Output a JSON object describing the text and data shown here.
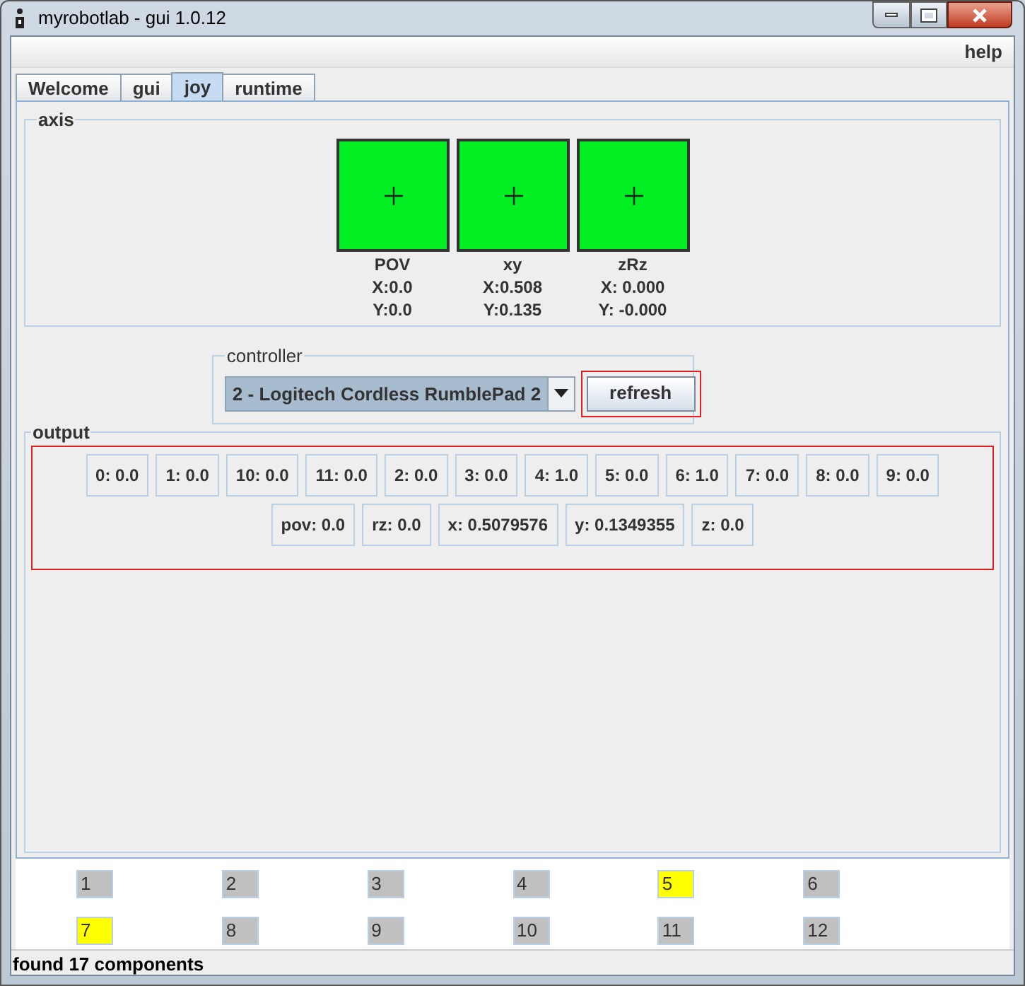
{
  "window": {
    "title": "myrobotlab - gui 1.0.12"
  },
  "menu": [
    "help"
  ],
  "tabs": [
    {
      "label": "Welcome",
      "selected": false
    },
    {
      "label": "gui",
      "selected": false
    },
    {
      "label": "joy",
      "selected": true
    },
    {
      "label": "runtime",
      "selected": false
    }
  ],
  "axis": {
    "title": "axis",
    "pads": [
      {
        "name": "POV",
        "x": "X:0.0",
        "y": "Y:0.0"
      },
      {
        "name": "xy",
        "x": "X:0.508",
        "y": "Y:0.135"
      },
      {
        "name": "zRz",
        "x": "X: 0.000",
        "y": "Y: -0.000"
      }
    ]
  },
  "controller": {
    "title": "controller",
    "selected": "2 - Logitech Cordless RumblePad 2",
    "button": "refresh"
  },
  "output": {
    "title": "output",
    "values": [
      {
        "label": "0:",
        "value": "0.0"
      },
      {
        "label": "1:",
        "value": "0.0"
      },
      {
        "label": "10:",
        "value": "0.0"
      },
      {
        "label": "11:",
        "value": "0.0"
      },
      {
        "label": "2:",
        "value": "0.0"
      },
      {
        "label": "3:",
        "value": "0.0"
      },
      {
        "label": "4:",
        "value": "1.0"
      },
      {
        "label": "5:",
        "value": "0.0"
      },
      {
        "label": "6:",
        "value": "1.0"
      },
      {
        "label": "7:",
        "value": "0.0"
      },
      {
        "label": "8:",
        "value": "0.0"
      },
      {
        "label": "9:",
        "value": "0.0"
      },
      {
        "label": "pov:",
        "value": "0.0"
      },
      {
        "label": "rz:",
        "value": "0.0"
      },
      {
        "label": "x:",
        "value": "0.5079576"
      },
      {
        "label": "y:",
        "value": "0.1349355"
      },
      {
        "label": "z:",
        "value": "0.0"
      }
    ]
  },
  "buttons": [
    {
      "label": "1",
      "pressed": false
    },
    {
      "label": "2",
      "pressed": false
    },
    {
      "label": "3",
      "pressed": false
    },
    {
      "label": "4",
      "pressed": false
    },
    {
      "label": "5",
      "pressed": true
    },
    {
      "label": "6",
      "pressed": false
    },
    {
      "label": "7",
      "pressed": true
    },
    {
      "label": "8",
      "pressed": false
    },
    {
      "label": "9",
      "pressed": false
    },
    {
      "label": "10",
      "pressed": false
    },
    {
      "label": "11",
      "pressed": false
    },
    {
      "label": "12",
      "pressed": false
    }
  ],
  "status_bar": "found 17 components"
}
